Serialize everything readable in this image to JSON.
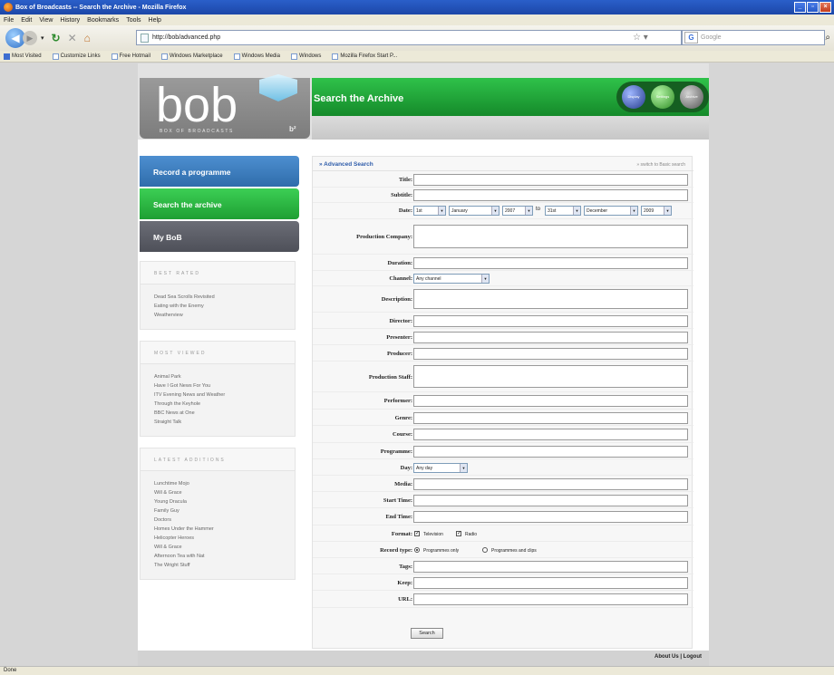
{
  "window": {
    "title": "Box of Broadcasts -- Search the Archive - Mozilla Firefox",
    "min": "_",
    "max": "▫",
    "close": "×"
  },
  "menu": [
    "File",
    "Edit",
    "View",
    "History",
    "Bookmarks",
    "Tools",
    "Help"
  ],
  "nav": {
    "url": "http://bob/advanced.php",
    "search_placeholder": "Google"
  },
  "bookmarks": [
    "Most Visited",
    "Customize Links",
    "Free Hotmail",
    "Windows Marketplace",
    "Windows Media",
    "Windows",
    "Mozilla Firefox Start P..."
  ],
  "status": "Done",
  "logo": {
    "text": "bob",
    "sub": "BOX OF BROADCASTS",
    "mark": "b²"
  },
  "header": {
    "title": "Search the Archive",
    "orbs": [
      "Display",
      "Settings",
      "Archive"
    ]
  },
  "sidebar": {
    "record": "Record a programme",
    "search": "Search the archive",
    "mybob": "My BoB",
    "best_rated": {
      "heading": "BEST RATED",
      "items": [
        "Dead Sea Scrolls Revisited",
        "Eating with the Enemy",
        "Weatherview"
      ]
    },
    "most_viewed": {
      "heading": "MOST VIEWED",
      "items": [
        "Animal Park",
        "Have I Got News For You",
        "ITV Evening News and Weather",
        "Through the Keyhole",
        "BBC News at One",
        "Straight Talk"
      ]
    },
    "latest": {
      "heading": "LATEST ADDITIONS",
      "items": [
        "Lunchtime Mojo",
        "Will & Grace",
        "Young Dracula",
        "Family Guy",
        "Doctors",
        "Homes Under the Hammer",
        "Helicopter Heroes",
        "Will & Grace",
        "Afternoon Tea with Nat",
        "The Wright Stuff"
      ]
    }
  },
  "form": {
    "title": "» Advanced Search",
    "switch": "» switch to Basic search",
    "labels": {
      "title": "Title:",
      "subtitle": "Subtitle:",
      "date": "Date:",
      "production_company": "Production Company:",
      "duration": "Duration:",
      "channel": "Channel:",
      "description": "Description:",
      "director": "Director:",
      "presenter": "Presenter:",
      "producer": "Producer:",
      "production_staff": "Production Staff:",
      "performer": "Performer:",
      "genre": "Genre:",
      "course": "Course:",
      "programme": "Programme:",
      "day": "Day:",
      "media": "Media:",
      "start_time": "Start Time:",
      "end_time": "End Time:",
      "format": "Format:",
      "record_type": "Record type:",
      "tags": "Tags:",
      "keep": "Keep:",
      "url": "URL:"
    },
    "date": {
      "from_day": "1st",
      "from_month": "January",
      "from_year": "2007",
      "to": "to",
      "to_day": "31st",
      "to_month": "December",
      "to_year": "2009"
    },
    "channel": "Any channel",
    "day": "Any day",
    "format": {
      "television": "Television",
      "radio": "Radio"
    },
    "record_type": {
      "programmes_only": "Programmes only",
      "programmes_and_clips": "Programmes and clips"
    },
    "search_button": "Search"
  },
  "footer": "About Us | Logout"
}
